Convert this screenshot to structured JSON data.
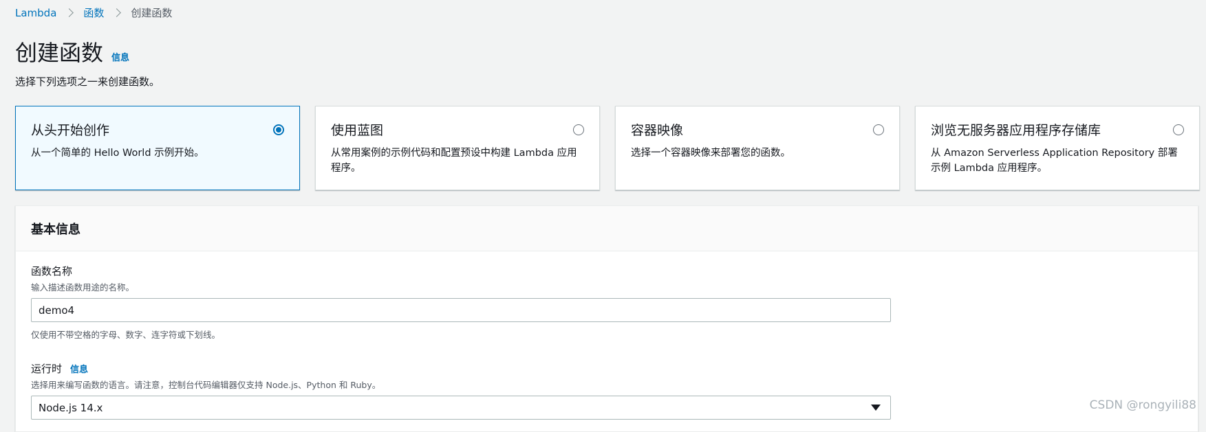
{
  "breadcrumb": {
    "items": [
      {
        "label": "Lambda"
      },
      {
        "label": "函数"
      }
    ],
    "current": "创建函数"
  },
  "header": {
    "title": "创建函数",
    "info_label": "信息",
    "subtitle": "选择下列选项之一来创建函数。"
  },
  "options": [
    {
      "title": "从头开始创作",
      "description": "从一个简单的 Hello World 示例开始。",
      "selected": true
    },
    {
      "title": "使用蓝图",
      "description": "从常用案例的示例代码和配置预设中构建 Lambda 应用程序。",
      "selected": false
    },
    {
      "title": "容器映像",
      "description": "选择一个容器映像来部署您的函数。",
      "selected": false
    },
    {
      "title": "浏览无服务器应用程序存储库",
      "description": "从 Amazon Serverless Application Repository 部署示例 Lambda 应用程序。",
      "selected": false
    }
  ],
  "basic_info": {
    "title": "基本信息",
    "function_name": {
      "label": "函数名称",
      "description": "输入描述函数用途的名称。",
      "value": "demo4",
      "constraint": "仅使用不带空格的字母、数字、连字符或下划线。"
    },
    "runtime": {
      "label": "运行时",
      "info_label": "信息",
      "description": "选择用来编写函数的语言。请注意，控制台代码编辑器仅支持 Node.js、Python 和 Ruby。",
      "selected": "Node.js 14.x"
    }
  },
  "watermark": "CSDN @rongyili88",
  "colors": {
    "link": "#0073bb",
    "selected_bg": "#f1faff",
    "page_bg": "#f2f3f3"
  }
}
